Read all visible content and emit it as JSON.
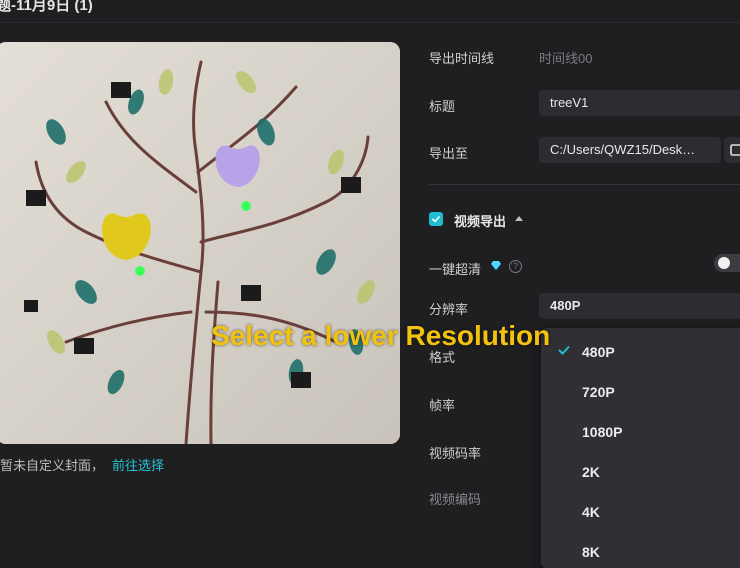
{
  "window": {
    "title": "题-11月9日 (1)"
  },
  "cover": {
    "note": "暂未自定义封面，",
    "link": "前往选择"
  },
  "form": {
    "timeline_label": "导出时间线",
    "timeline_value": "时间线00",
    "title_label": "标题",
    "title_value": "treeV1",
    "export_to_label": "导出至",
    "export_path": "C:/Users/QWZ15/Desk…",
    "video_export_label": "视频导出",
    "hd_label": "一键超清",
    "resolution_label": "分辨率",
    "resolution_value": "480P",
    "format_label": "格式",
    "framerate_label": "帧率",
    "bitrate_label": "视频码率",
    "codec_label": "视频编码"
  },
  "resolution_options": [
    "480P",
    "720P",
    "1080P",
    "2K",
    "4K",
    "8K"
  ],
  "selected_resolution": "480P",
  "caption": "Select a lower Resolution",
  "colors": {
    "accent": "#20bcd0",
    "caption": "#f3c20f",
    "background": "#1f1f22"
  },
  "icons": [
    "diamond-icon",
    "help-icon",
    "folder-icon",
    "check-icon",
    "caret-up-icon"
  ]
}
